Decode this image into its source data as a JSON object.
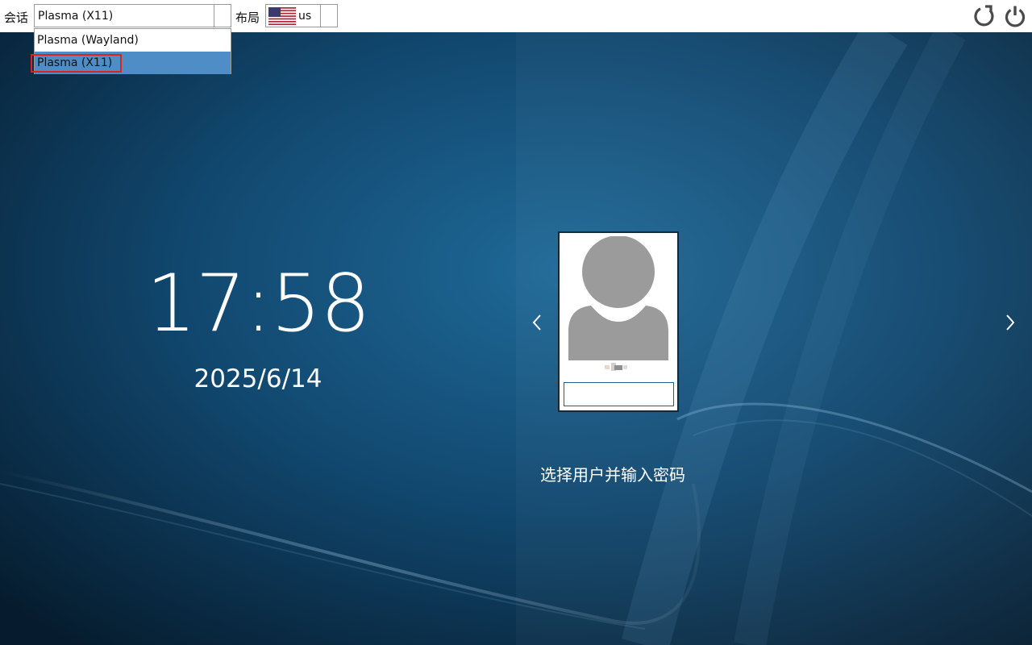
{
  "topbar": {
    "session_label": "会话",
    "session_value": "Plasma (X11)",
    "session_options": [
      "Plasma (Wayland)",
      "Plasma (X11)"
    ],
    "layout_label": "布局",
    "layout_value": "us"
  },
  "icons": {
    "restart": "restart-icon",
    "power": "power-icon",
    "flag": "us-flag-icon",
    "prev": "chevron-left-icon",
    "next": "chevron-right-icon"
  },
  "clock": {
    "time": "17:58",
    "date": "2025/6/14"
  },
  "login": {
    "password_value": "",
    "prompt": "选择用户并输入密码"
  },
  "colors": {
    "background": "#0c3550",
    "selected_option": "#4f8dc6",
    "highlight_border": "#e02020",
    "avatar": "#9b9b9b"
  }
}
